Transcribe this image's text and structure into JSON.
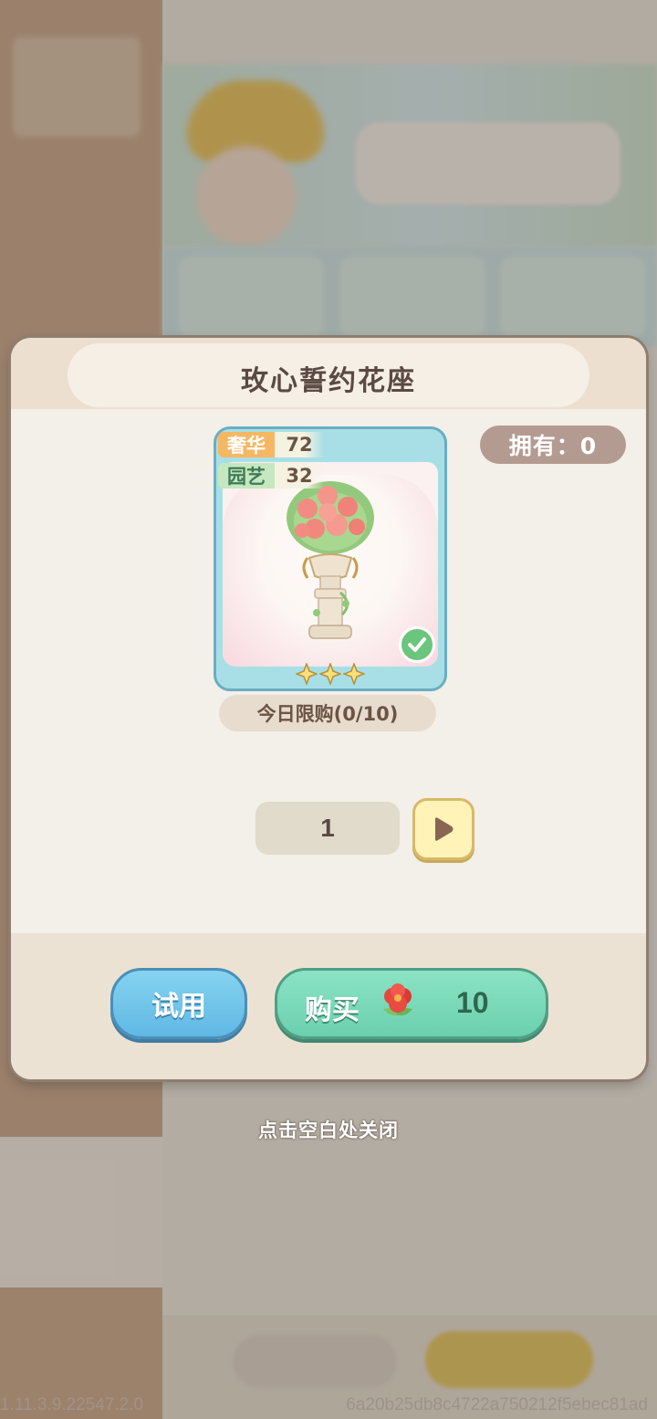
{
  "dialog": {
    "title": "玫心誓约花座",
    "owned": "拥有：0"
  },
  "item": {
    "icon": "rose-vase-icon",
    "stats": [
      {
        "name": "奢华",
        "value": "72"
      },
      {
        "name": "园艺",
        "value": "32"
      }
    ],
    "stars": 3,
    "owned_check": true
  },
  "purchase": {
    "daily_limit": "今日限购(0/10)",
    "quantity": "1",
    "try_label": "试用",
    "buy_label": "购买",
    "currency_icon": "red-flower-icon",
    "price": "10"
  },
  "close_hint": "点击空白处关闭",
  "debug": {
    "version": "1.11.3.9.22547.2.0",
    "hash": "6a20b25db8c4722a750212f5ebec81ad"
  },
  "colors": {
    "title": "#5a4a42",
    "try_button": "#5fb8e4",
    "buy_button": "#6bd0ae",
    "owned_badge": "#b49b92",
    "luxury_tag": "#f6b763",
    "garden_tag": "#c5e8c0"
  }
}
